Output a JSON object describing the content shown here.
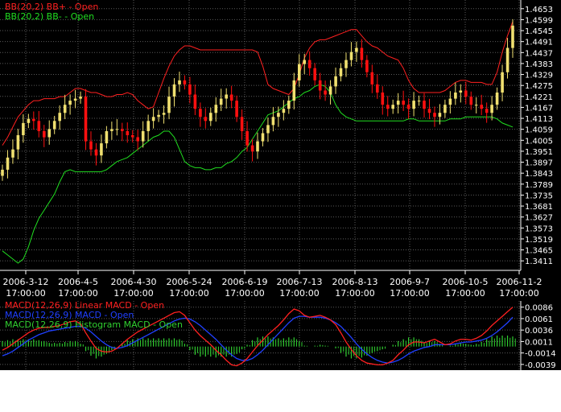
{
  "chart_data": [
    {
      "type": "line",
      "title": "",
      "legend": [
        {
          "label": "BB(20,2) BB+ - Open",
          "color": "#ff2020"
        },
        {
          "label": "BB(20,2) BB- - Open",
          "color": "#20dd20"
        }
      ],
      "ylim": [
        1.338,
        1.468
      ],
      "y_ticks": [
        "1.4653",
        "1.4599",
        "1.4545",
        "1.4491",
        "1.4437",
        "1.4383",
        "1.4329",
        "1.4275",
        "1.4221",
        "1.4167",
        "1.4113",
        "1.4059",
        "1.4005",
        "1.3951",
        "1.3897",
        "1.3843",
        "1.3789",
        "1.3735",
        "1.3681",
        "1.3627",
        "1.3573",
        "1.3519",
        "1.3465",
        "1.3411"
      ],
      "x_ticks": [
        {
          "date": "2006-3-12",
          "time": "17:00:00"
        },
        {
          "date": "2006-4-5",
          "time": "17:00:00"
        },
        {
          "date": "2006-4-30",
          "time": "17:00:00"
        },
        {
          "date": "2006-5-24",
          "time": "17:00:00"
        },
        {
          "date": "2006-6-19",
          "time": "17:00:00"
        },
        {
          "date": "2006-7-13",
          "time": "17:00:00"
        },
        {
          "date": "2006-8-13",
          "time": "17:00:00"
        },
        {
          "date": "2006-9-7",
          "time": "17:00:00"
        },
        {
          "date": "2006-10-5",
          "time": "17:00:00"
        },
        {
          "date": "2006-11-2",
          "time": "17:00:00"
        }
      ],
      "grid": true,
      "series": [
        {
          "name": "BB(20,2) BB+ - Open",
          "color": "#ff2020",
          "values": [
            1.398,
            1.402,
            1.407,
            1.412,
            1.415,
            1.418,
            1.42,
            1.42,
            1.421,
            1.421,
            1.421,
            1.422,
            1.422,
            1.424,
            1.426,
            1.426,
            1.425,
            1.424,
            1.424,
            1.423,
            1.422,
            1.422,
            1.423,
            1.423,
            1.424,
            1.423,
            1.42,
            1.418,
            1.416,
            1.417,
            1.424,
            1.431,
            1.437,
            1.442,
            1.445,
            1.447,
            1.447,
            1.446,
            1.445,
            1.445,
            1.445,
            1.445,
            1.445,
            1.445,
            1.445,
            1.445,
            1.445,
            1.445,
            1.445,
            1.444,
            1.437,
            1.428,
            1.426,
            1.425,
            1.424,
            1.423,
            1.426,
            1.433,
            1.441,
            1.446,
            1.449,
            1.45,
            1.45,
            1.451,
            1.452,
            1.453,
            1.454,
            1.455,
            1.455,
            1.452,
            1.449,
            1.447,
            1.446,
            1.444,
            1.442,
            1.441,
            1.44,
            1.436,
            1.43,
            1.426,
            1.424,
            1.424,
            1.424,
            1.424,
            1.424,
            1.425,
            1.427,
            1.429,
            1.43,
            1.43,
            1.429,
            1.429,
            1.429,
            1.428,
            1.428,
            1.434,
            1.444,
            1.452,
            1.459
          ]
        },
        {
          "name": "BB(20,2) BB- - Open",
          "color": "#20dd20",
          "values": [
            1.346,
            1.344,
            1.342,
            1.34,
            1.342,
            1.348,
            1.356,
            1.362,
            1.366,
            1.37,
            1.374,
            1.38,
            1.385,
            1.386,
            1.385,
            1.385,
            1.385,
            1.385,
            1.385,
            1.385,
            1.386,
            1.388,
            1.39,
            1.391,
            1.392,
            1.394,
            1.396,
            1.398,
            1.4,
            1.402,
            1.403,
            1.405,
            1.405,
            1.402,
            1.396,
            1.39,
            1.388,
            1.387,
            1.387,
            1.386,
            1.386,
            1.387,
            1.387,
            1.389,
            1.39,
            1.392,
            1.395,
            1.397,
            1.401,
            1.405,
            1.409,
            1.413,
            1.414,
            1.415,
            1.417,
            1.419,
            1.421,
            1.422,
            1.424,
            1.425,
            1.427,
            1.428,
            1.427,
            1.424,
            1.418,
            1.414,
            1.412,
            1.411,
            1.41,
            1.41,
            1.41,
            1.41,
            1.41,
            1.41,
            1.41,
            1.41,
            1.41,
            1.41,
            1.411,
            1.411,
            1.41,
            1.41,
            1.41,
            1.41,
            1.41,
            1.41,
            1.411,
            1.411,
            1.411,
            1.412,
            1.412,
            1.412,
            1.412,
            1.412,
            1.412,
            1.411,
            1.409,
            1.408,
            1.407
          ]
        }
      ],
      "candles": {
        "up_color": "#f0e070",
        "down_color": "#ff1010",
        "close": [
          1.386,
          1.392,
          1.396,
          1.403,
          1.409,
          1.411,
          1.41,
          1.405,
          1.402,
          1.406,
          1.41,
          1.414,
          1.418,
          1.42,
          1.421,
          1.422,
          1.4,
          1.396,
          1.393,
          1.399,
          1.405,
          1.406,
          1.406,
          1.405,
          1.403,
          1.402,
          1.4,
          1.405,
          1.41,
          1.412,
          1.413,
          1.414,
          1.422,
          1.428,
          1.43,
          1.428,
          1.423,
          1.416,
          1.412,
          1.41,
          1.414,
          1.418,
          1.421,
          1.423,
          1.42,
          1.412,
          1.405,
          1.398,
          1.395,
          1.4,
          1.404,
          1.408,
          1.412,
          1.414,
          1.416,
          1.42,
          1.43,
          1.438,
          1.44,
          1.436,
          1.43,
          1.425,
          1.423,
          1.427,
          1.432,
          1.436,
          1.44,
          1.444,
          1.446,
          1.44,
          1.434,
          1.428,
          1.424,
          1.418,
          1.416,
          1.418,
          1.42,
          1.418,
          1.416,
          1.42,
          1.42,
          1.416,
          1.414,
          1.412,
          1.414,
          1.418,
          1.421,
          1.424,
          1.425,
          1.422,
          1.418,
          1.418,
          1.416,
          1.414,
          1.418,
          1.424,
          1.434,
          1.446,
          1.457
        ]
      }
    },
    {
      "type": "line",
      "title": "",
      "legend": [
        {
          "label": "MACD(12,26,9) Linear MACD - Open",
          "color": "#ff2020"
        },
        {
          "label": "MACD(12,26,9) MACD - Open",
          "color": "#2040ff"
        },
        {
          "label": "MACD(12,26,9) Histogram MACD - Open",
          "color": "#30d030"
        }
      ],
      "ylim": [
        -0.0048,
        0.0096
      ],
      "y_ticks": [
        "0.0086",
        "0.0061",
        "0.0036",
        "0.0011",
        "-0.0014",
        "-0.0039"
      ],
      "grid": true,
      "series": [
        {
          "name": "MACD(12,26,9) Linear MACD - Open",
          "color": "#ff2020",
          "values": [
            -0.0008,
            -0.0002,
            0.0006,
            0.0014,
            0.0022,
            0.003,
            0.0036,
            0.004,
            0.0042,
            0.0042,
            0.0044,
            0.0046,
            0.005,
            0.0054,
            0.0056,
            0.005,
            0.003,
            0.0012,
            -0.0004,
            -0.001,
            -0.0012,
            -0.001,
            -0.0004,
            0.0006,
            0.0016,
            0.0024,
            0.0032,
            0.0038,
            0.0044,
            0.005,
            0.0056,
            0.0062,
            0.0068,
            0.0074,
            0.0076,
            0.0068,
            0.0052,
            0.0036,
            0.0024,
            0.0014,
            0.0004,
            -0.0008,
            -0.0018,
            -0.003,
            -0.004,
            -0.0042,
            -0.0036,
            -0.0026,
            -0.0012,
            0.0002,
            0.0014,
            0.0026,
            0.0036,
            0.0046,
            0.0058,
            0.0072,
            0.0082,
            0.0078,
            0.0068,
            0.0064,
            0.0066,
            0.0068,
            0.0064,
            0.0058,
            0.0048,
            0.003,
            0.001,
            -0.0006,
            -0.002,
            -0.003,
            -0.0036,
            -0.0038,
            -0.004,
            -0.004,
            -0.0036,
            -0.003,
            -0.0018,
            -0.0008,
            0.0004,
            0.001,
            0.001,
            0.0008,
            0.0012,
            0.0016,
            0.001,
            0.0004,
            0.0006,
            0.0012,
            0.0016,
            0.0016,
            0.0014,
            0.0018,
            0.0024,
            0.0034,
            0.0046,
            0.0056,
            0.0066,
            0.0076,
            0.0086
          ]
        },
        {
          "name": "MACD(12,26,9) MACD - Open",
          "color": "#2040ff",
          "values": [
            -0.002,
            -0.0016,
            -0.001,
            -0.0002,
            0.0006,
            0.0014,
            0.002,
            0.0026,
            0.003,
            0.0034,
            0.0036,
            0.0038,
            0.004,
            0.0042,
            0.0044,
            0.0044,
            0.004,
            0.0032,
            0.0022,
            0.0012,
            0.0004,
            -0.0002,
            -0.0004,
            -0.0002,
            0.0002,
            0.0008,
            0.0014,
            0.002,
            0.0026,
            0.0032,
            0.0038,
            0.0044,
            0.005,
            0.0056,
            0.006,
            0.0062,
            0.006,
            0.0054,
            0.0046,
            0.0036,
            0.0026,
            0.0016,
            0.0004,
            -0.0008,
            -0.0018,
            -0.0026,
            -0.003,
            -0.003,
            -0.0026,
            -0.0018,
            -0.0008,
            0.0004,
            0.0016,
            0.0028,
            0.004,
            0.0052,
            0.0062,
            0.0066,
            0.0066,
            0.0064,
            0.0064,
            0.0064,
            0.0062,
            0.0058,
            0.0052,
            0.0044,
            0.0032,
            0.002,
            0.0006,
            -0.0006,
            -0.0016,
            -0.0024,
            -0.003,
            -0.0034,
            -0.0036,
            -0.0034,
            -0.003,
            -0.0024,
            -0.0016,
            -0.001,
            -0.0006,
            -0.0002,
            0.0,
            0.0004,
            0.0004,
            0.0004,
            0.0004,
            0.0006,
            0.0008,
            0.001,
            0.001,
            0.0012,
            0.0014,
            0.0018,
            0.0024,
            0.0032,
            0.0042,
            0.0052,
            0.0064
          ]
        },
        {
          "name": "MACD(12,26,9) Histogram MACD - Open",
          "color": "#30d030",
          "type": "bar",
          "values": [
            0.0012,
            0.0014,
            0.0016,
            0.0016,
            0.0016,
            0.0016,
            0.0016,
            0.0014,
            0.0012,
            0.0008,
            0.0008,
            0.0008,
            0.001,
            0.0012,
            0.0012,
            0.0006,
            -0.001,
            -0.002,
            -0.0026,
            -0.0022,
            -0.0016,
            -0.0008,
            0.0,
            0.0008,
            0.0014,
            0.0016,
            0.0018,
            0.0018,
            0.0018,
            0.0018,
            0.0018,
            0.0018,
            0.0018,
            0.0018,
            0.0016,
            0.0006,
            -0.0008,
            -0.0018,
            -0.0022,
            -0.0022,
            -0.0022,
            -0.0024,
            -0.0022,
            -0.0022,
            -0.0022,
            -0.0016,
            -0.0006,
            0.0004,
            0.0014,
            0.002,
            0.0022,
            0.0022,
            0.002,
            0.0018,
            0.0018,
            0.002,
            0.002,
            0.0012,
            0.0002,
            0.0,
            0.0002,
            0.0004,
            0.0002,
            0.0,
            -0.0004,
            -0.0014,
            -0.0022,
            -0.0026,
            -0.0026,
            -0.0024,
            -0.002,
            -0.0014,
            -0.001,
            -0.0006,
            0.0,
            0.0004,
            0.0012,
            0.0016,
            0.002,
            0.002,
            0.0016,
            0.001,
            0.0012,
            0.0012,
            0.0006,
            0.0,
            0.0002,
            0.0006,
            0.0008,
            0.0006,
            0.0004,
            0.0006,
            0.001,
            0.0016,
            0.0022,
            0.0024,
            0.0024,
            0.0024,
            0.0022
          ]
        }
      ]
    }
  ]
}
